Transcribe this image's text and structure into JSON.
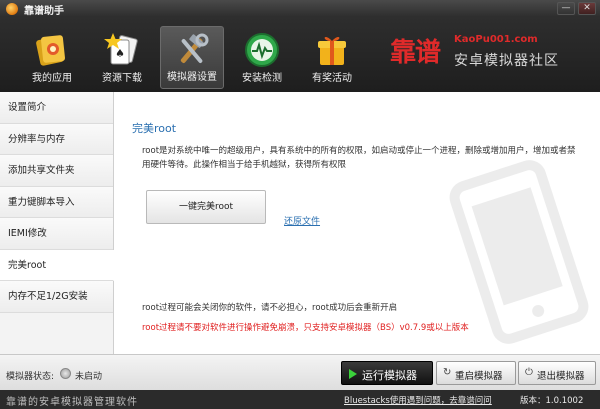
{
  "titlebar": {
    "title": "靠谱助手",
    "minimize_glyph": "—",
    "close_glyph": "✕"
  },
  "nav": {
    "items": [
      {
        "label": "我的应用",
        "icon": "book-icon"
      },
      {
        "label": "资源下载",
        "icon": "cards-star-icon"
      },
      {
        "label": "模拟器设置",
        "icon": "tools-icon",
        "active": true
      },
      {
        "label": "安装检测",
        "icon": "monitor-check-icon"
      },
      {
        "label": "有奖活动",
        "icon": "gift-icon"
      }
    ]
  },
  "brand": {
    "name": "靠谱",
    "url": "KaoPu001.com",
    "subtitle": "安卓模拟器社区"
  },
  "sidebar": {
    "items": [
      {
        "label": "设置简介"
      },
      {
        "label": "分辨率与内存"
      },
      {
        "label": "添加共享文件夹"
      },
      {
        "label": "重力键脚本导入"
      },
      {
        "label": "IEMI修改"
      },
      {
        "label": "完美root",
        "active": true
      },
      {
        "label": "内存不足1/2G安装"
      }
    ]
  },
  "content": {
    "title": "完美root",
    "description": "root是对系统中唯一的超级用户，具有系统中的所有的权限，如启动或停止一个进程，删除或增加用户，增加或者禁用硬件等待。此操作相当于给手机越狱，获得所有权限",
    "root_button": "一键完美root",
    "restore_link": "还原文件",
    "note1": "root过程可能会关闭你的软件，请不必担心，root成功后会重新开启",
    "note2": "root过程请不要对软件进行操作避免崩溃，只支持安卓模拟器（BS）v0.7.9或以上版本"
  },
  "status": {
    "label": "模拟器状态:",
    "value": "未启动",
    "run_button": "运行模拟器",
    "restart_button": "重启模拟器",
    "exit_button": "退出模拟器"
  },
  "footer": {
    "tagline": "靠谱的安卓模拟器管理软件",
    "link": "Bluestacks使用遇到问题，去靠谱问问",
    "version": "版本：1.0.1002"
  },
  "colors": {
    "accent_blue": "#2a6fb0",
    "warning_red": "#e02020",
    "brand_red": "#e02a2a",
    "run_green": "#3bd23b"
  }
}
